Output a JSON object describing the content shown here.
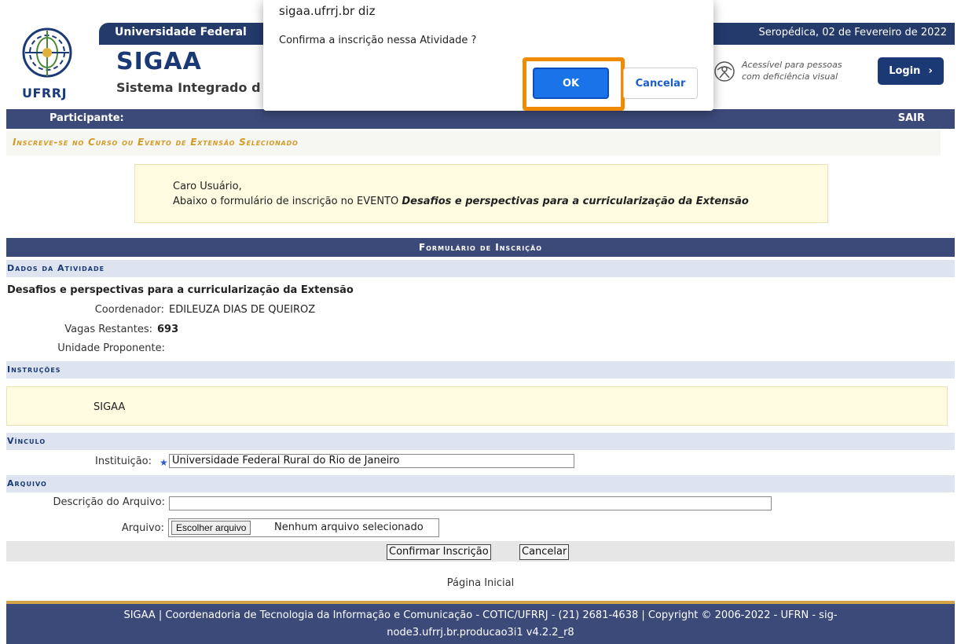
{
  "header": {
    "logo_text": "UFRRJ",
    "university": "Universidade Federal",
    "date": "Seropédica, 02 de Fevereiro de 2022",
    "app_title": "SIGAA",
    "app_subtitle": "Sistema Integrado d",
    "accessibility_line1": "Acessível para pessoas",
    "accessibility_line2": "com deficiência visual",
    "login_label": "Login",
    "login_arrow": "›"
  },
  "menu": {
    "participante": "Participante:",
    "sair": "SAIR"
  },
  "section_title": "Inscreve-se no Curso ou Evento de Extensão Selecionado",
  "info": {
    "greeting": "Caro Usuário,",
    "line_prefix": "Abaixo o formulário de inscrição no EVENTO ",
    "event_name": "Desafios e perspectivas para a curricularização da Extensão"
  },
  "form": {
    "caption": "Formulário de Inscrição",
    "dados_header": "Dados da Atividade",
    "activity_name": "Desafios e perspectivas para a curricularização da Extensão",
    "coordenador_label": "Coordenador:",
    "coordenador_value": "EDILEUZA DIAS DE QUEIROZ",
    "vagas_label": "Vagas Restantes:",
    "vagas_value": "693",
    "unidade_label": "Unidade Proponente:",
    "instrucoes_header": "Instruções",
    "instrucoes_text": "SIGAA",
    "vinculo_header": "Vínculo",
    "instituicao_label": "Instituição:",
    "instituicao_value": "Universidade Federal Rural do Rio de Janeiro",
    "arquivo_header": "Arquivo",
    "descricao_label": "Descrição do Arquivo:",
    "descricao_value": "",
    "arquivo_label": "Arquivo:",
    "choose_file": "Escolher arquivo",
    "no_file": "Nenhum arquivo selecionado",
    "confirm_button": "Confirmar Inscrição",
    "cancel_button": "Cancelar"
  },
  "pagina_inicial": "Página Inicial",
  "footer": {
    "line1": "SIGAA | Coordenadoria de Tecnologia da Informação e Comunicação - COTIC/UFRRJ - (21) 2681-4638 | Copyright © 2006-2022 - UFRN - sig-",
    "line2": "node3.ufrrj.br.producao3i1 v4.2.2_r8"
  },
  "dialog": {
    "title": "sigaa.ufrrj.br diz",
    "message": "Confirma a inscrição nessa Atividade ?",
    "ok_label": "OK",
    "cancel_label": "Cancelar"
  },
  "colors": {
    "header_blue": "#233a6b",
    "menu_blue": "#3c4a7a",
    "section_gold": "#d49a26",
    "highlight_orange": "#f08a00",
    "ok_blue": "#1a73e8"
  }
}
